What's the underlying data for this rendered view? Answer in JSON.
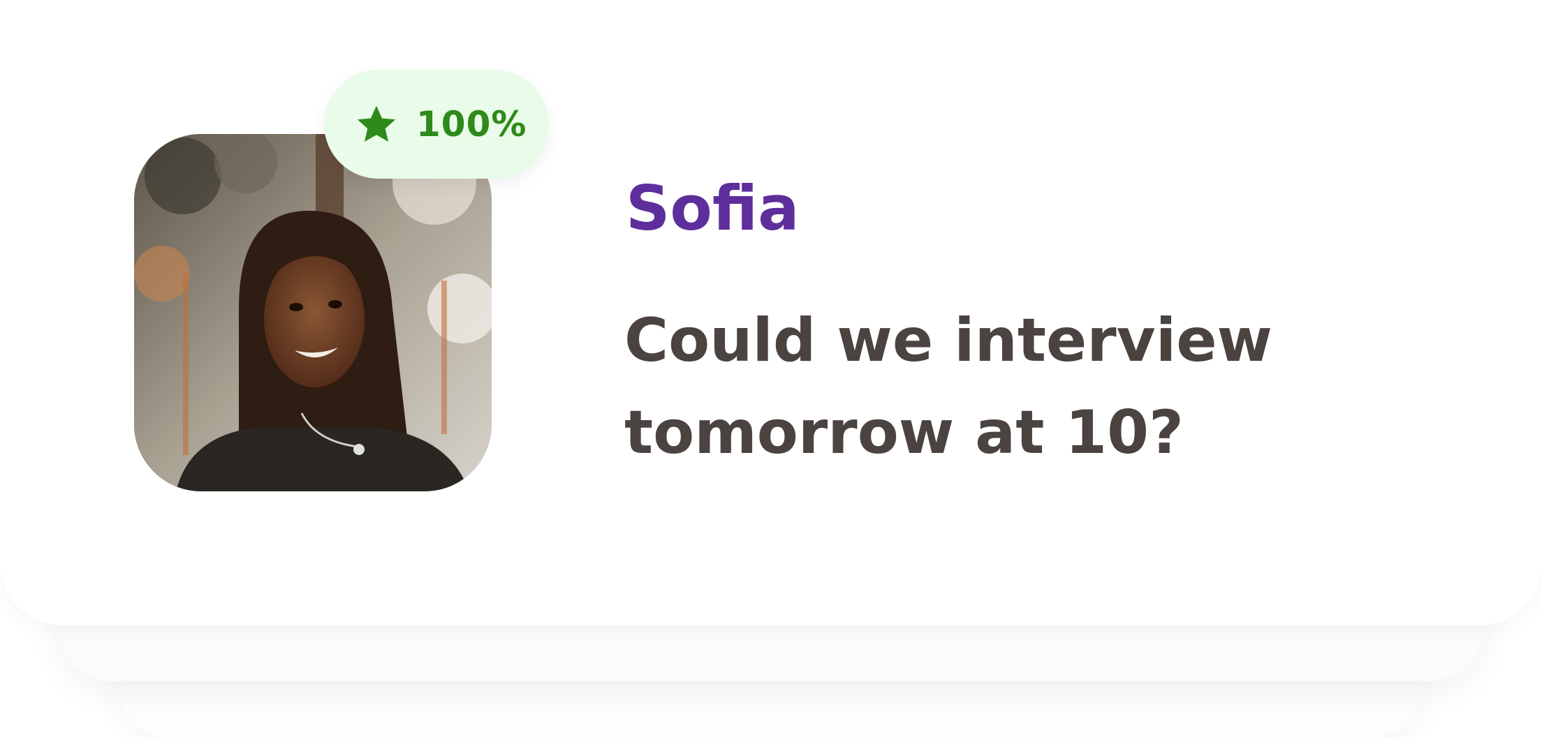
{
  "card": {
    "name": "Sofia",
    "rating": "100%",
    "rating_icon": "star-icon",
    "message_lines": [
      "Could we interview",
      "tomorrow at 10?"
    ]
  },
  "colors": {
    "name": "#5d2e9c",
    "message": "#4a4340",
    "badge_bg": "#e9fbe9",
    "badge_text": "#2e8a1b"
  }
}
